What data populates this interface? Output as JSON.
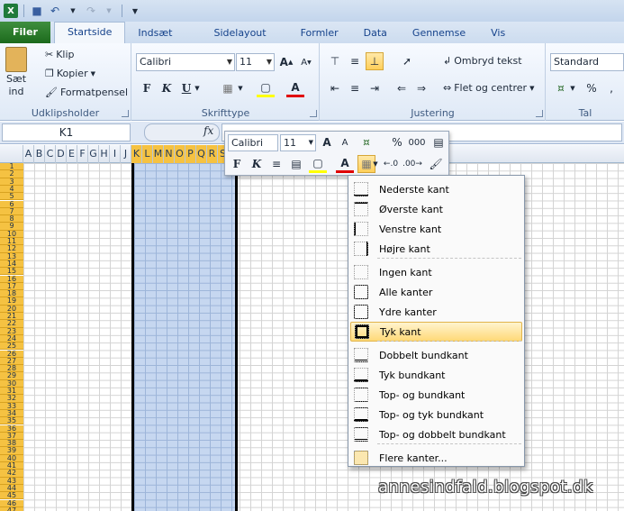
{
  "tabs": [
    {
      "label": "Filer"
    },
    {
      "label": "Startside"
    },
    {
      "label": "Indsæt"
    },
    {
      "label": "Sidelayout"
    },
    {
      "label": "Formler"
    },
    {
      "label": "Data"
    },
    {
      "label": "Gennemse"
    },
    {
      "label": "Vis"
    }
  ],
  "ribbon": {
    "clipboard": {
      "paste_line1": "Sæt",
      "paste_line2": "ind",
      "cut": "Klip",
      "copy": "Kopier",
      "format_painter": "Formatpensel",
      "label": "Udklipsholder"
    },
    "font": {
      "family": "Calibri",
      "size": "11",
      "label": "Skrifttype"
    },
    "alignment": {
      "wrap_text": "Ombryd tekst",
      "merge_center": "Flet og centrer",
      "label": "Justering"
    },
    "number": {
      "format": "Standard",
      "label": "Tal"
    }
  },
  "formula_bar": {
    "name_box": "K1",
    "fx": "fx",
    "formula": ""
  },
  "mini_toolbar": {
    "font": "Calibri",
    "size": "11",
    "percent": "%",
    "thousands": "000"
  },
  "columns": [
    "A",
    "B",
    "C",
    "D",
    "E",
    "F",
    "G",
    "H",
    "I",
    "J",
    "K",
    "L",
    "M",
    "N",
    "O",
    "P",
    "Q",
    "R",
    "S"
  ],
  "rows": [
    "1",
    "2",
    "3",
    "4",
    "5",
    "6",
    "7",
    "8",
    "9",
    "10",
    "11",
    "12",
    "13",
    "14",
    "15",
    "16",
    "17",
    "18",
    "19",
    "20",
    "21",
    "22",
    "23",
    "24",
    "25",
    "26",
    "27",
    "28",
    "29",
    "30",
    "31",
    "32",
    "33",
    "34",
    "35",
    "36",
    "37",
    "38",
    "39",
    "40",
    "41",
    "42",
    "43",
    "44",
    "45",
    "46",
    "47"
  ],
  "border_menu": {
    "items": [
      {
        "label": "Nederste kant"
      },
      {
        "label": "Øverste kant"
      },
      {
        "label": "Venstre kant"
      },
      {
        "label": "Højre kant"
      },
      {
        "label": "Ingen kant"
      },
      {
        "label": "Alle kanter"
      },
      {
        "label": "Ydre kanter"
      },
      {
        "label": "Tyk kant"
      },
      {
        "label": "Dobbelt bundkant"
      },
      {
        "label": "Tyk bundkant"
      },
      {
        "label": "Top- og bundkant"
      },
      {
        "label": "Top- og tyk bundkant"
      },
      {
        "label": "Top- og dobbelt bundkant"
      },
      {
        "label": "Flere kanter..."
      }
    ],
    "highlighted": "Tyk kant"
  },
  "watermark": "annesindfald.blogspot.dk",
  "colors": {
    "file_tab": "#2a7a2a",
    "selection": "#c6d7f0",
    "row_header_highlight": "#f5c242",
    "menu_highlight": "#ffd978"
  }
}
